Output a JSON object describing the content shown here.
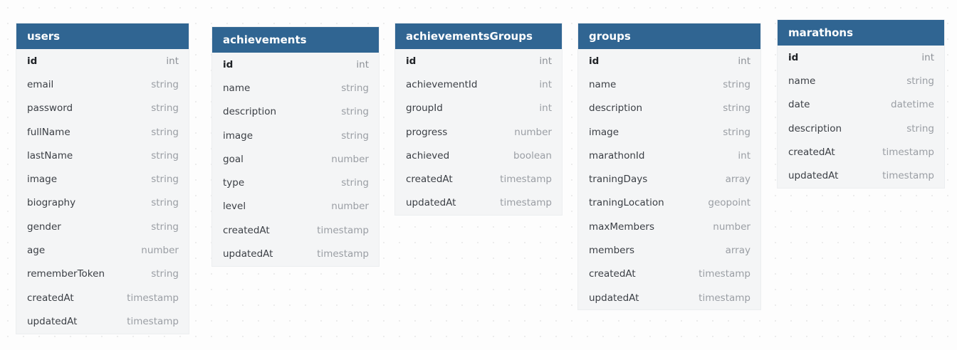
{
  "tables": [
    {
      "id": "users",
      "name": "users",
      "fields": [
        {
          "name": "id",
          "type": "int",
          "pk": true
        },
        {
          "name": "email",
          "type": "string"
        },
        {
          "name": "password",
          "type": "string"
        },
        {
          "name": "fullName",
          "type": "string"
        },
        {
          "name": "lastName",
          "type": "string"
        },
        {
          "name": "image",
          "type": "string"
        },
        {
          "name": "biography",
          "type": "string"
        },
        {
          "name": "gender",
          "type": "string"
        },
        {
          "name": "age",
          "type": "number"
        },
        {
          "name": "rememberToken",
          "type": "string"
        },
        {
          "name": "createdAt",
          "type": "timestamp"
        },
        {
          "name": "updatedAt",
          "type": "timestamp"
        }
      ]
    },
    {
      "id": "achievements",
      "name": "achievements",
      "fields": [
        {
          "name": "id",
          "type": "int",
          "pk": true
        },
        {
          "name": "name",
          "type": "string"
        },
        {
          "name": "description",
          "type": "string"
        },
        {
          "name": "image",
          "type": "string"
        },
        {
          "name": "goal",
          "type": "number"
        },
        {
          "name": "type",
          "type": "string"
        },
        {
          "name": "level",
          "type": "number"
        },
        {
          "name": "createdAt",
          "type": "timestamp"
        },
        {
          "name": "updatedAt",
          "type": "timestamp"
        }
      ]
    },
    {
      "id": "achievementsGroups",
      "name": "achievementsGroups",
      "fields": [
        {
          "name": "id",
          "type": "int",
          "pk": true
        },
        {
          "name": "achievementId",
          "type": "int"
        },
        {
          "name": "groupId",
          "type": "int"
        },
        {
          "name": "progress",
          "type": "number"
        },
        {
          "name": "achieved",
          "type": "boolean"
        },
        {
          "name": "createdAt",
          "type": "timestamp"
        },
        {
          "name": "updatedAt",
          "type": "timestamp"
        }
      ]
    },
    {
      "id": "groups",
      "name": "groups",
      "fields": [
        {
          "name": "id",
          "type": "int",
          "pk": true
        },
        {
          "name": "name",
          "type": "string"
        },
        {
          "name": "description",
          "type": "string"
        },
        {
          "name": "image",
          "type": "string"
        },
        {
          "name": "marathonId",
          "type": "int"
        },
        {
          "name": "traningDays",
          "type": "array"
        },
        {
          "name": "traningLocation",
          "type": "geopoint"
        },
        {
          "name": "maxMembers",
          "type": "number"
        },
        {
          "name": "members",
          "type": "array"
        },
        {
          "name": "createdAt",
          "type": "timestamp"
        },
        {
          "name": "updatedAt",
          "type": "timestamp"
        }
      ]
    },
    {
      "id": "marathons",
      "name": "marathons",
      "fields": [
        {
          "name": "id",
          "type": "int",
          "pk": true
        },
        {
          "name": "name",
          "type": "string"
        },
        {
          "name": "date",
          "type": "datetime"
        },
        {
          "name": "description",
          "type": "string"
        },
        {
          "name": "createdAt",
          "type": "timestamp"
        },
        {
          "name": "updatedAt",
          "type": "timestamp"
        }
      ]
    }
  ]
}
